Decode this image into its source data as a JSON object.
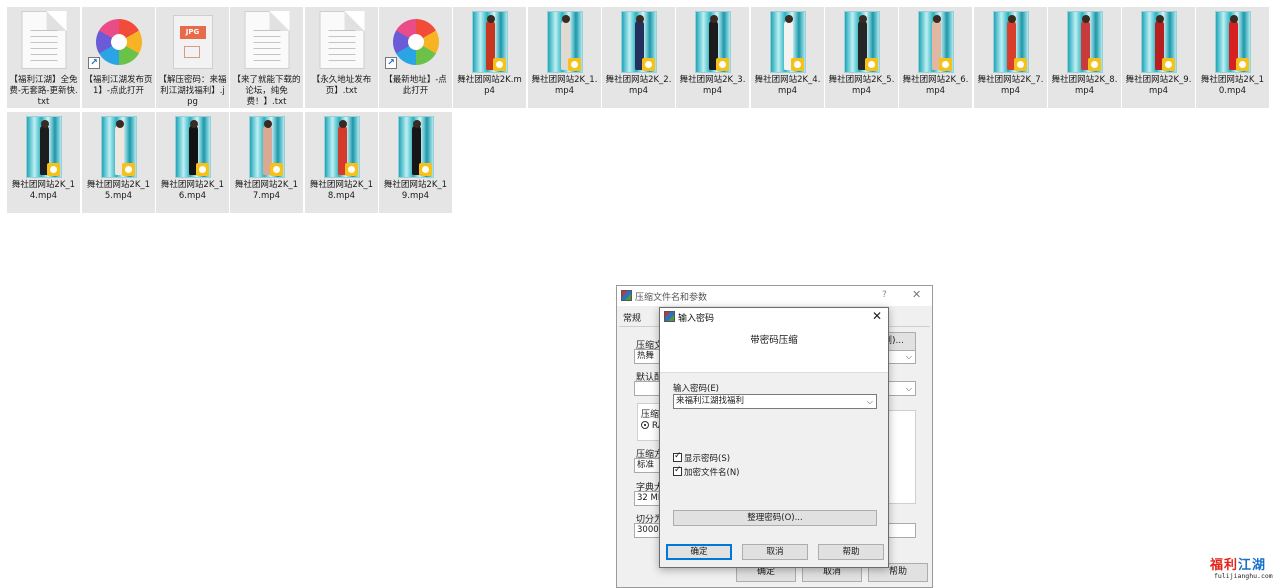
{
  "files": [
    {
      "name": "【福利江湖】全免费-无套路-更新快.txt",
      "type": "txt"
    },
    {
      "name": "【福利江湖发布页1】-点此打开",
      "type": "shortcut"
    },
    {
      "name": "【解压密码：来福利江湖找福利】.jpg",
      "type": "jpg"
    },
    {
      "name": "【来了就能下载的论坛，纯免费！】.txt",
      "type": "txt"
    },
    {
      "name": "【永久地址发布页】.txt",
      "type": "txt"
    },
    {
      "name": "【最新地址】-点此打开",
      "type": "shortcut"
    },
    {
      "name": "舞社团网站2K.mp4",
      "type": "video",
      "color": "#c7361f"
    },
    {
      "name": "舞社团网站2K_1.mp4",
      "type": "video",
      "color": "#e0d9d1"
    },
    {
      "name": "舞社团网站2K_2.mp4",
      "type": "video",
      "color": "#23305e"
    },
    {
      "name": "舞社团网站2K_3.mp4",
      "type": "video",
      "color": "#1b1b1b"
    },
    {
      "name": "舞社团网站2K_4.mp4",
      "type": "video",
      "color": "#f3f3f1"
    },
    {
      "name": "舞社团网站2K_5.mp4",
      "type": "video",
      "color": "#262626"
    },
    {
      "name": "舞社团网站2K_6.mp4",
      "type": "video",
      "color": "#e2b8a4"
    },
    {
      "name": "舞社团网站2K_7.mp4",
      "type": "video",
      "color": "#d93d2c"
    },
    {
      "name": "舞社团网站2K_8.mp4",
      "type": "video",
      "color": "#c93b3b"
    },
    {
      "name": "舞社团网站2K_9.mp4",
      "type": "video",
      "color": "#b81f1f"
    },
    {
      "name": "舞社团网站2K_10.mp4",
      "type": "video",
      "color": "#d82020"
    },
    {
      "name": "舞社团网站2K_14.mp4",
      "type": "video",
      "color": "#1d1d1d"
    },
    {
      "name": "舞社团网站2K_15.mp4",
      "type": "video",
      "color": "#efe7df"
    },
    {
      "name": "舞社团网站2K_16.mp4",
      "type": "video",
      "color": "#121212"
    },
    {
      "name": "舞社团网站2K_17.mp4",
      "type": "video",
      "color": "#dba894"
    },
    {
      "name": "舞社团网站2K_18.mp4",
      "type": "video",
      "color": "#d63a2a"
    },
    {
      "name": "舞社团网站2K_19.mp4",
      "type": "video",
      "color": "#161616"
    }
  ],
  "archive_dialog": {
    "title": "压缩文件名和参数",
    "help": "?",
    "close": "✕",
    "tab_general": "常规",
    "label_archive": "压缩文",
    "field_archive": "热舞",
    "browse_label": "浏)...",
    "label_default": "默认配",
    "label_format": "压缩文",
    "radio_rar": "RA",
    "label_method": "压缩方",
    "field_method": "标准",
    "label_dict": "字典大",
    "field_dict": "32 MB",
    "label_split": "切分为",
    "field_split": "3000",
    "ok": "确定",
    "cancel": "取消",
    "help_btn": "帮助"
  },
  "password_dialog": {
    "title": "输入密码",
    "close": "✕",
    "header": "带密码压缩",
    "password_label": "输入密码(E)",
    "password_value": "来福利江湖找福利",
    "show_password": "显示密码(S)",
    "encrypt_names": "加密文件名(N)",
    "organize": "整理密码(O)...",
    "ok": "确定",
    "cancel": "取消",
    "help": "帮助"
  },
  "watermark": {
    "brand_red": "福利",
    "brand_blue": "江湖",
    "url": "fulijianghu.com"
  }
}
